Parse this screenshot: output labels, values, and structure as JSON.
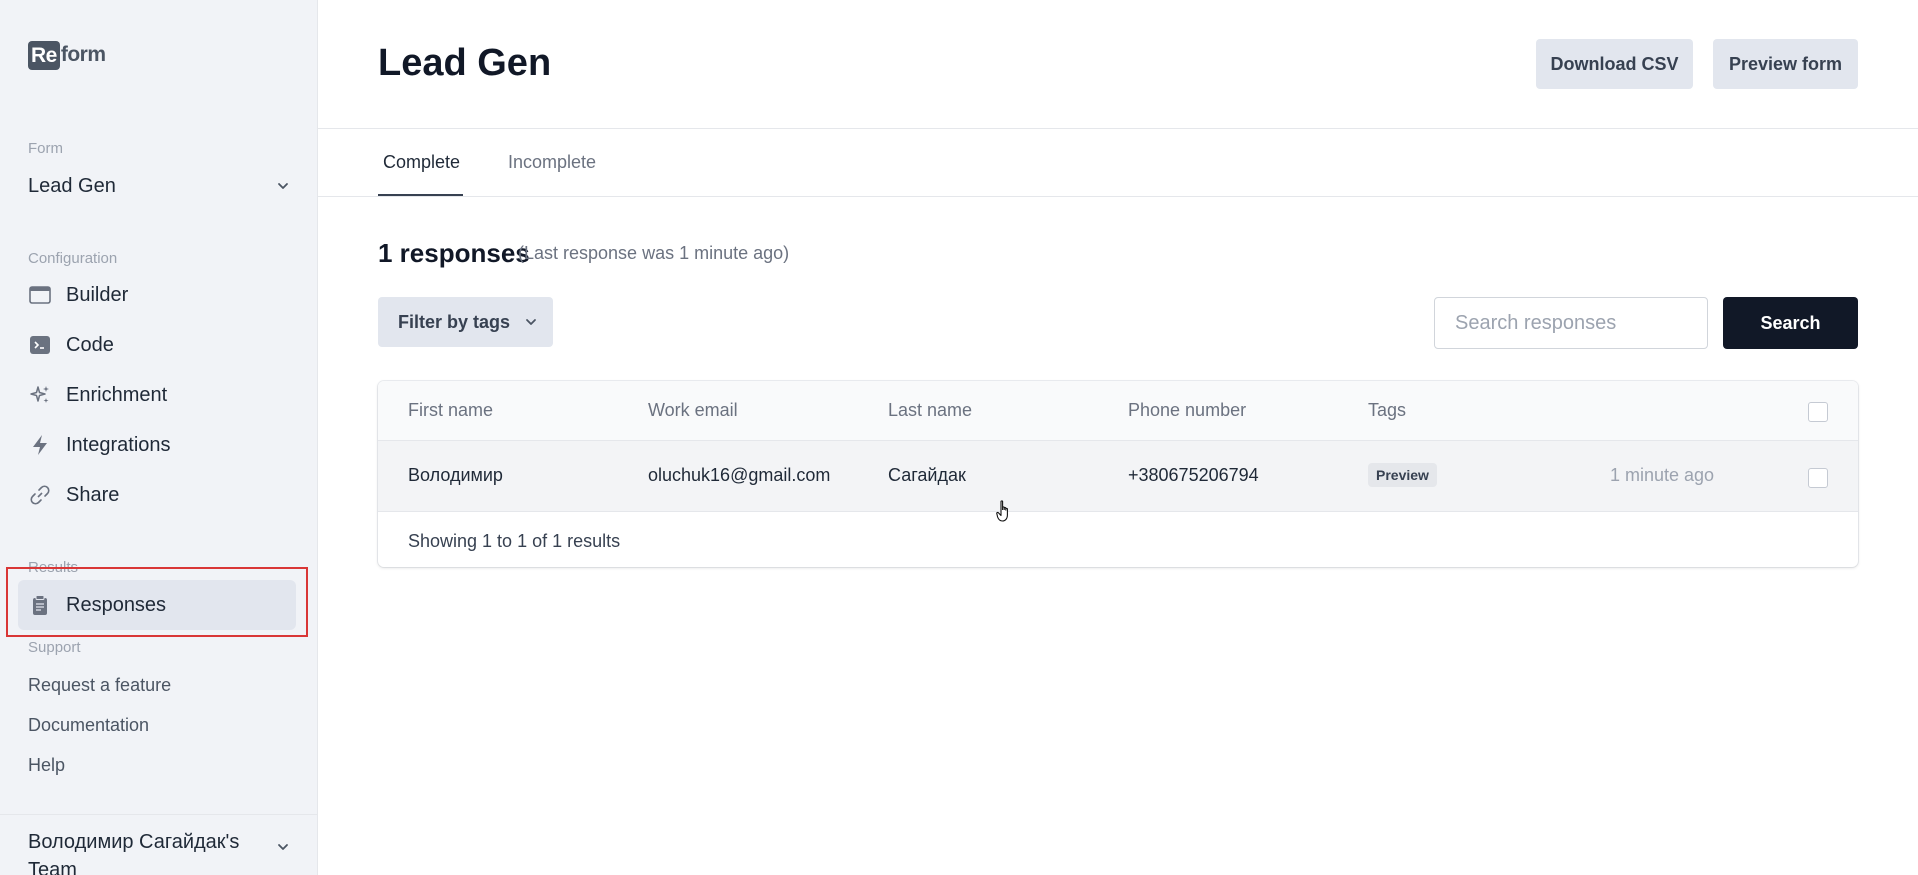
{
  "logo": {
    "badge": "Re",
    "rest": "form"
  },
  "sidebar": {
    "form_section": "Form",
    "form_name": "Lead Gen",
    "configuration_section": "Configuration",
    "config_items": [
      {
        "label": "Builder",
        "icon": "window-icon"
      },
      {
        "label": "Code",
        "icon": "terminal-icon"
      },
      {
        "label": "Enrichment",
        "icon": "sparkles-icon"
      },
      {
        "label": "Integrations",
        "icon": "lightning-icon"
      },
      {
        "label": "Share",
        "icon": "link-icon"
      }
    ],
    "results_section": "Results",
    "results_items": [
      {
        "label": "Responses",
        "icon": "clipboard-icon",
        "active": true
      }
    ],
    "support_section": "Support",
    "support_items": [
      "Request a feature",
      "Documentation",
      "Help"
    ],
    "team": "Володимир Сагайдак's Team"
  },
  "header": {
    "title": "Lead Gen",
    "download_csv": "Download CSV",
    "preview_form": "Preview form"
  },
  "tabs": [
    {
      "label": "Complete",
      "active": true
    },
    {
      "label": "Incomplete",
      "active": false
    }
  ],
  "responses": {
    "count_label": "1 responses",
    "last_response": "(Last response was 1 minute ago)",
    "filter_label": "Filter by tags",
    "search_placeholder": "Search responses",
    "search_button": "Search"
  },
  "table": {
    "columns": [
      "First name",
      "Work email",
      "Last name",
      "Phone number",
      "Tags"
    ],
    "rows": [
      {
        "first_name": "Володимир",
        "work_email": "oluchuk16@gmail.com",
        "last_name": "Сагайдак",
        "phone": "+380675206794",
        "tag": "Preview",
        "time": "1 minute ago"
      }
    ],
    "footer": "Showing 1 to 1 of 1 results"
  },
  "colors": {
    "accent_dark": "#111827",
    "sidebar_bg": "#f1f3f7",
    "highlight_border": "#d93636"
  }
}
